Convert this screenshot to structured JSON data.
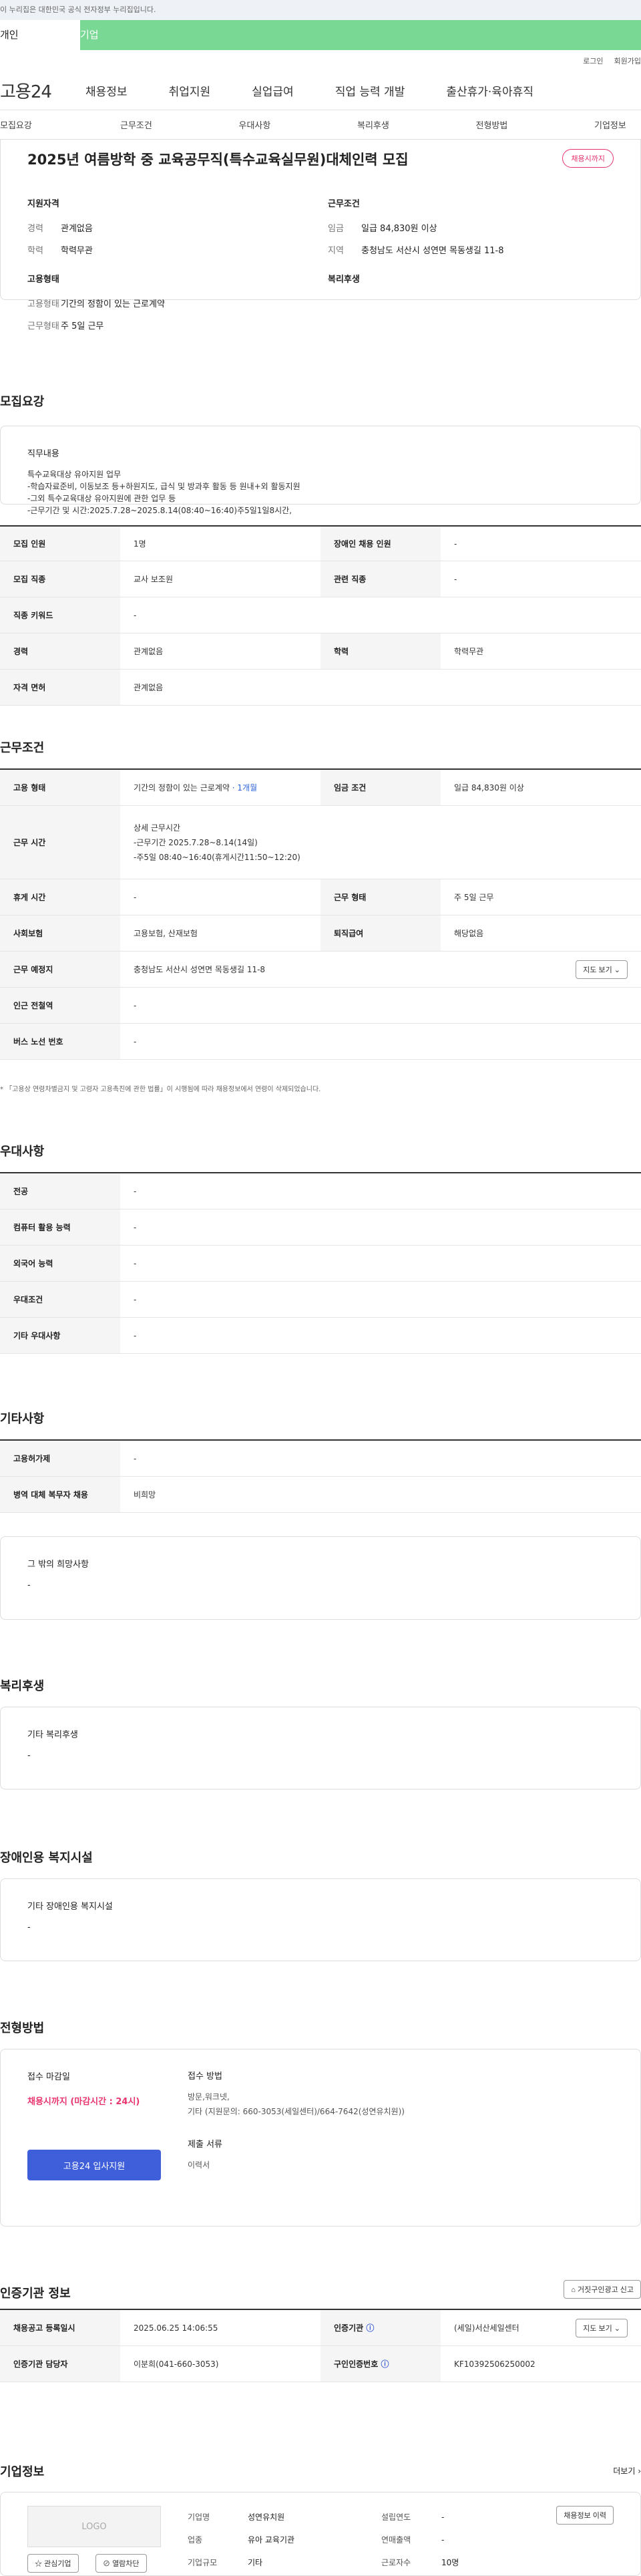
{
  "gov_banner": "이 누리집은 대한민국 공식 전자정부 누리집입니다.",
  "tabs": [
    "개인",
    "기업"
  ],
  "topright": [
    "로그인",
    "회원가입"
  ],
  "logo": "고용24",
  "gnb": [
    "채용정보",
    "취업지원",
    "실업급여",
    "직업 능력 개발",
    "출산휴가·육아휴직"
  ],
  "anchors": [
    "모집요강",
    "근무조건",
    "우대사항",
    "복리후생",
    "전형방법",
    "기업정보"
  ],
  "job": {
    "title": "2025년 여름방학 중 교육공무직(특수교육실무원)대체인력 모집",
    "badge": "채용시까지",
    "qual_h": "지원자격",
    "qual": [
      [
        "경력",
        "관계없음"
      ],
      [
        "학력",
        "학력무관"
      ]
    ],
    "emp_h": "고용형태",
    "emp": [
      [
        "고용형태",
        "기간의 정함이 있는 근로계약"
      ],
      [
        "근무형태",
        "주 5일 근무"
      ]
    ],
    "cond_h": "근무조건",
    "cond": [
      [
        "임금",
        "일급 84,830원 이상"
      ],
      [
        "지역",
        "충청남도 서산시 성연면 목동생길 11-8"
      ]
    ],
    "welfare_h": "복리후생"
  },
  "recruit": {
    "title": "모집요강",
    "duty_h": "직무내용",
    "duty": [
      "특수교육대상 유아지원 업무",
      "-학습자료준비, 이동보조 등+하원지도, 급식 및 방과후 활동 등 원내+외 활동지원",
      "-그외 특수교육대상 유아지원에 관한 업무 등",
      "-근무기간 및 시간:2025.7.28~2025.8.14(08:40~16:40)주5일1일8시간,"
    ],
    "rows": [
      [
        "모집 인원",
        "1명",
        "장애인 채용 인원",
        "-"
      ],
      [
        "모집 직종",
        "교사 보조원",
        "관련 직종",
        "-"
      ],
      [
        "직종 키워드",
        "-"
      ],
      [
        "경력",
        "관계없음",
        "학력",
        "학력무관"
      ],
      [
        "자격 면허",
        "관계없음"
      ]
    ]
  },
  "work": {
    "title": "근무조건",
    "type_h": "고용 형태",
    "type": "기간의 정함이 있는 근로계약",
    "type_sub": "· 1개월",
    "wage_h": "임금 조건",
    "wage": "일급 84,830원 이상",
    "time_h": "근무 시간",
    "time": [
      "상세 근무시간",
      "-근무기간 2025.7.28~8.14(14일)",
      "-주5일 08:40~16:40(휴게시간11:50~12:20)"
    ],
    "rows": [
      [
        "휴게 시간",
        "-",
        "근무 형태",
        "주 5일 근무"
      ],
      [
        "사회보험",
        "고용보험, 산재보험",
        "퇴직급여",
        "해당없음"
      ]
    ],
    "place_h": "근무 예정지",
    "place": "충청남도 서산시 성연면 목동생길 11-8",
    "map_btn": "지도 보기",
    "rows2": [
      [
        "인근 전철역",
        "-"
      ],
      [
        "버스 노선 번호",
        "-"
      ]
    ],
    "note": "「고용상 연령차별금지 및 고령자 고용촉진에 관한 법률」이 시행됨에 따라 채용정보에서 연령이 삭제되었습니다."
  },
  "pref": {
    "title": "우대사항",
    "rows": [
      [
        "전공",
        "-"
      ],
      [
        "컴퓨터 활용 능력",
        "-"
      ],
      [
        "외국어 능력",
        "-"
      ],
      [
        "우대조건",
        "-"
      ],
      [
        "기타 우대사항",
        "-"
      ]
    ]
  },
  "etc": {
    "title": "기타사항",
    "rows": [
      [
        "고용허가제",
        "-"
      ],
      [
        "병역 대체 복무자 채용",
        "비희망"
      ]
    ],
    "box_h": "그 밖의 희망사항",
    "box_v": "-"
  },
  "welfare": {
    "title": "복리후생",
    "box_h": "기타 복리후생",
    "box_v": "-"
  },
  "disab": {
    "title": "장애인용 복지시설",
    "box_h": "기타 장애인용 복지시설",
    "box_v": "-"
  },
  "screen": {
    "title": "전형방법",
    "deadline_h": "접수 마감일",
    "deadline": "채용시까지 (마감시간 : 24시)",
    "apply_btn": "고용24 입사지원",
    "method_h": "접수 방법",
    "method": [
      "방문,워크넷,",
      "기타 (지원문의: 660-3053(세일센터)/664-7642(성연유치원))"
    ],
    "docs_h": "제출 서류",
    "docs": "이력서"
  },
  "agency": {
    "title": "인증기관 정보",
    "report_btn": "거짓구인광고 신고",
    "reg_h": "채용공고 등록일시",
    "reg": "2025.06.25 14:06:55",
    "org_h": "인증기관",
    "org": "(세일)서산세일센터",
    "map_btn": "지도 보기",
    "mgr_h": "인증기관 담당자",
    "mgr": "이분희(041-660-3053)",
    "no_h": "구인인증번호",
    "no": "KF10392506250002"
  },
  "company": {
    "title": "기업정보",
    "more": "더보기",
    "logo": "LOGO",
    "like": "관심기업",
    "block": "열람차단",
    "history_btn": "채용정보 이력",
    "rows": [
      [
        "기업명",
        "성연유치원",
        "설립연도",
        "-"
      ],
      [
        "업종",
        "유아 교육기관",
        "연매출액",
        "-"
      ],
      [
        "기업규모",
        "기타",
        "근로자수",
        "10명"
      ]
    ]
  }
}
